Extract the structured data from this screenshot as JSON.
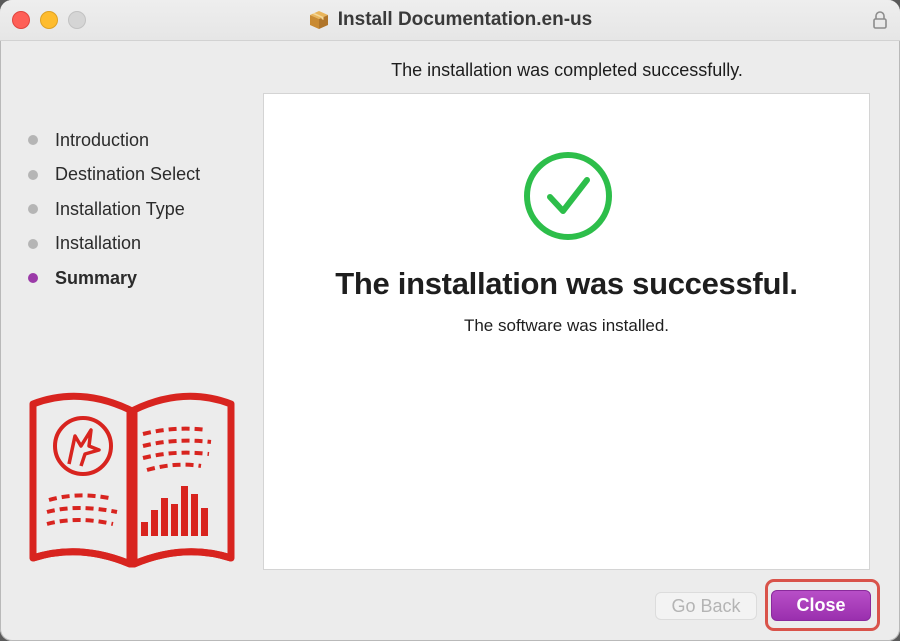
{
  "window": {
    "title": "Install Documentation.en-us",
    "title_icon": "package-icon",
    "lock_icon": "lock-icon"
  },
  "header": {
    "message": "The installation was completed successfully."
  },
  "sidebar": {
    "steps": [
      {
        "label": "Introduction",
        "active": false
      },
      {
        "label": "Destination Select",
        "active": false
      },
      {
        "label": "Installation Type",
        "active": false
      },
      {
        "label": "Installation",
        "active": false
      },
      {
        "label": "Summary",
        "active": true
      }
    ],
    "active_color": "#9b3aa8",
    "inactive_color": "#b5b5b5",
    "logo": "documentation-book-logo"
  },
  "main": {
    "status_icon": "checkmark-circle-icon",
    "title": "The installation was successful.",
    "subtitle": "The software was installed."
  },
  "footer": {
    "back_label": "Go Back",
    "back_enabled": false,
    "close_label": "Close"
  },
  "colors": {
    "accent": "#9b3aa8",
    "success": "#2dbe4a",
    "logo_red": "#d8241f",
    "highlight": "#d9534a"
  }
}
